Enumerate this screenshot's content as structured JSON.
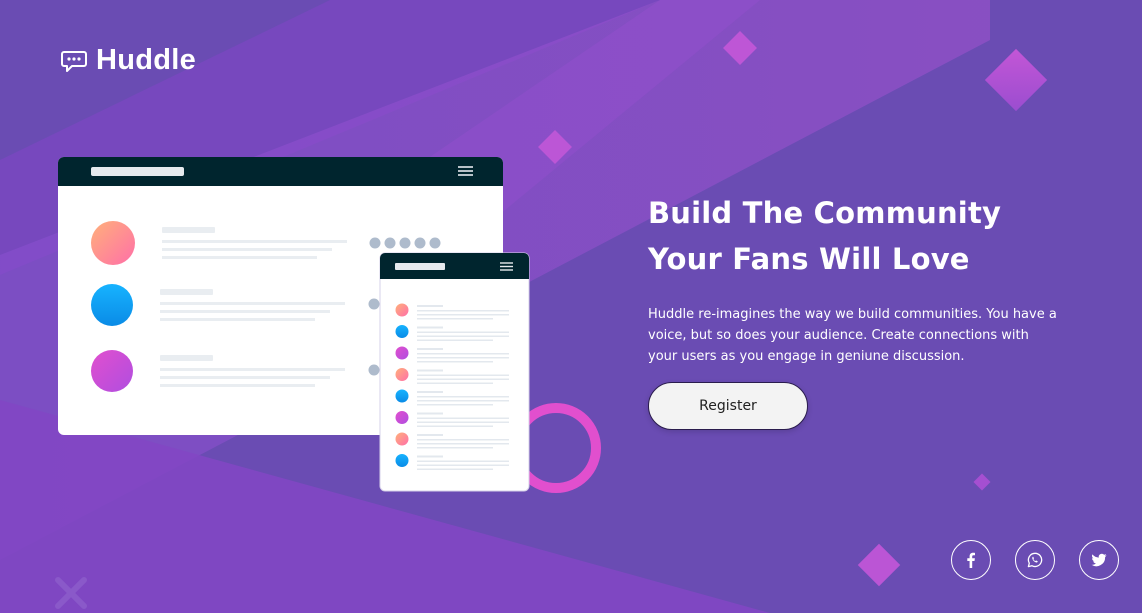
{
  "brand": {
    "name": "Huddle",
    "logo_icon": "chat-bubble-icon"
  },
  "hero": {
    "title_line1": "Build The Community",
    "title_line2": "Your Fans Will Love",
    "description": "Huddle re-imagines the way we build communities. You have a voice, but so does your audience. Create connections with your users as you engage in geniune discussion.",
    "register_label": "Register"
  },
  "social": [
    {
      "name": "facebook",
      "icon": "facebook-icon"
    },
    {
      "name": "whatsapp",
      "icon": "whatsapp-icon"
    },
    {
      "name": "twitter",
      "icon": "twitter-icon"
    }
  ],
  "colors": {
    "background": "#6a4cb3",
    "accent_pink": "#e14fce",
    "mockup_header": "#00252e",
    "button_bg": "#f3f3f3"
  }
}
